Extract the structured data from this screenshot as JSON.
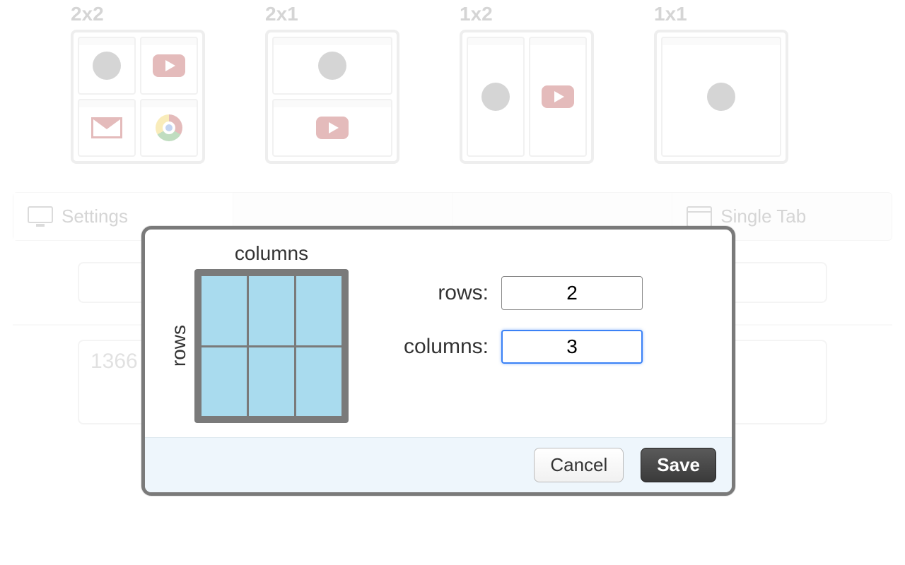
{
  "presets": [
    {
      "label": "2x2"
    },
    {
      "label": "2x1"
    },
    {
      "label": "1x2"
    },
    {
      "label": "1x1"
    }
  ],
  "tabs": {
    "settings": "Settings",
    "single_tab": "Single Tab"
  },
  "lower": {
    "value": "1366"
  },
  "modal": {
    "axis_top": "columns",
    "axis_left": "rows",
    "rows_label": "rows:",
    "columns_label": "columns:",
    "rows_value": "2",
    "columns_value": "3",
    "cancel": "Cancel",
    "save": "Save"
  }
}
